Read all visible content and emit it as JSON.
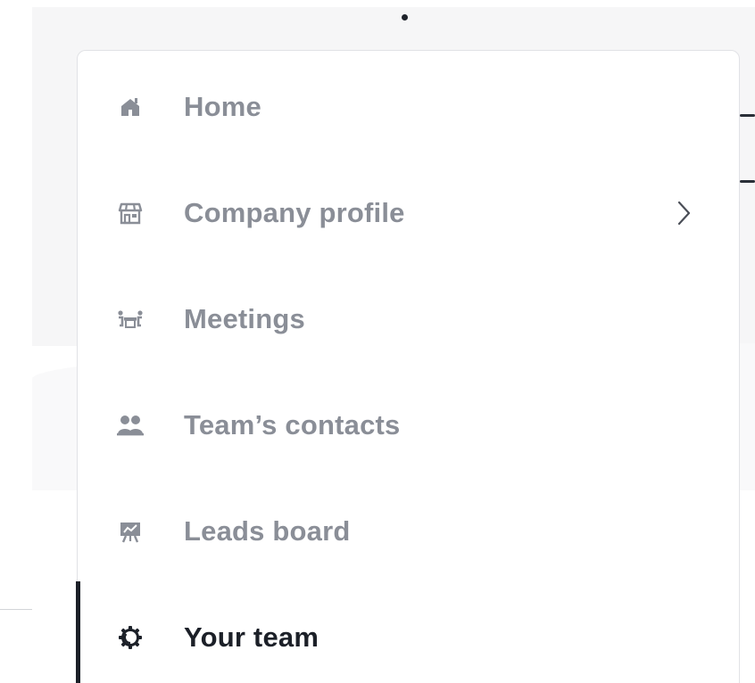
{
  "menu": {
    "items": [
      {
        "label": "Home",
        "icon": "home-icon",
        "has_submenu": false,
        "active": false
      },
      {
        "label": "Company profile",
        "icon": "storefront-icon",
        "has_submenu": true,
        "active": false
      },
      {
        "label": "Meetings",
        "icon": "meeting-table-icon",
        "has_submenu": false,
        "active": false
      },
      {
        "label": "Team’s contacts",
        "icon": "contacts-icon",
        "has_submenu": false,
        "active": false
      },
      {
        "label": "Leads board",
        "icon": "presentation-board-icon",
        "has_submenu": false,
        "active": false
      },
      {
        "label": "Your team",
        "icon": "gear-icon",
        "has_submenu": false,
        "active": true
      }
    ]
  },
  "colors": {
    "inactive_text": "#8a8e97",
    "active_text": "#1c2028",
    "active_indicator": "#1c2028",
    "menu_border": "#e1e2e6"
  }
}
